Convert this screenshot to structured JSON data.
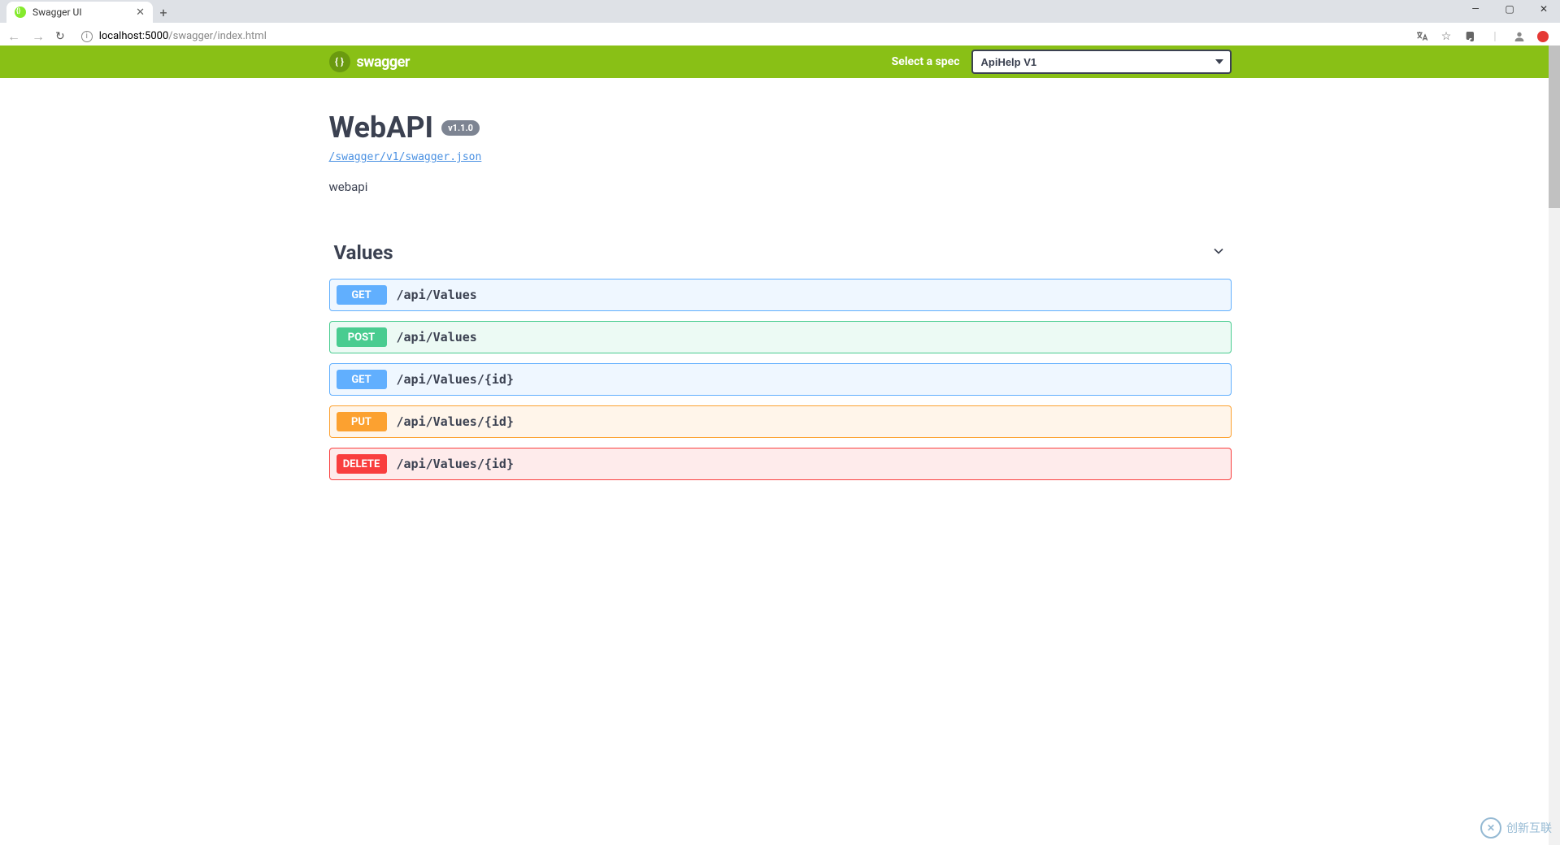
{
  "browser": {
    "tab_title": "Swagger UI",
    "url_host": "localhost:5000",
    "url_path": "/swagger/index.html"
  },
  "topbar": {
    "logo_text": "swagger",
    "spec_label": "Select a spec",
    "spec_selected": "ApiHelp V1"
  },
  "api": {
    "title": "WebAPI",
    "version": "v1.1.0",
    "swagger_json_link": "/swagger/v1/swagger.json",
    "description": "webapi"
  },
  "tag": {
    "name": "Values"
  },
  "operations": [
    {
      "method": "GET",
      "css": "get",
      "path": "/api/Values"
    },
    {
      "method": "POST",
      "css": "post",
      "path": "/api/Values"
    },
    {
      "method": "GET",
      "css": "get",
      "path": "/api/Values/{id}"
    },
    {
      "method": "PUT",
      "css": "put",
      "path": "/api/Values/{id}"
    },
    {
      "method": "DELETE",
      "css": "delete",
      "path": "/api/Values/{id}"
    }
  ],
  "watermark": "创新互联"
}
